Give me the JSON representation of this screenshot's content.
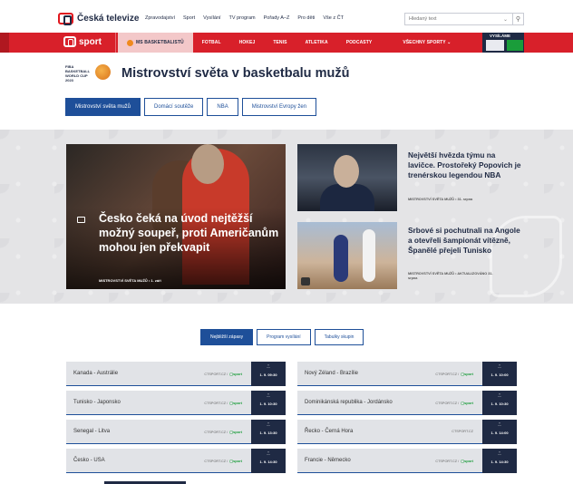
{
  "header": {
    "brand": "Česká televize",
    "nav": [
      "Zpravodajství",
      "Sport",
      "Vysílání",
      "TV program",
      "Pořady A–Z",
      "Pro děti",
      "Vše z ČT"
    ],
    "search_placeholder": "Hledaný text"
  },
  "sportbar": {
    "brand": "sport",
    "items": [
      {
        "label": "MS BASKETBALISTŮ",
        "active": true
      },
      {
        "label": "FOTBAL",
        "active": false
      },
      {
        "label": "HOKEJ",
        "active": false
      },
      {
        "label": "TENIS",
        "active": false
      },
      {
        "label": "ATLETIKA",
        "active": false
      },
      {
        "label": "PODCASTY",
        "active": false
      },
      {
        "label": "VŠECHNY SPORTY ⌄",
        "active": false
      }
    ],
    "live_label": "VYSÍLÁME"
  },
  "page": {
    "logo_text": "FIBA BASKETBALL WORLD CUP 2023",
    "title": "Mistrovství světa v basketbalu mužů",
    "tabs": [
      {
        "label": "Mistrovství světa mužů",
        "active": true
      },
      {
        "label": "Domácí soutěže",
        "active": false
      },
      {
        "label": "NBA",
        "active": false
      },
      {
        "label": "Mistrovství Evropy žen",
        "active": false
      }
    ]
  },
  "hero": {
    "main": {
      "headline": "Česko čeká na úvod nejtěžší možný soupeř, proti Američanům mohou jen překvapit",
      "meta": "MISTROVSTVÍ SVĚTA MUŽŮ • 1. září"
    },
    "side": [
      {
        "title": "Největší hvězda týmu na lavičce. Prostořeký Popovich je trenérskou legendou NBA",
        "meta": "MISTROVSTVÍ SVĚTA MUŽŮ • 31. srpna"
      },
      {
        "title": "Srbové si pochutnali na Angole a otevřeli šampionát vítězně, Španělé přejeli Tunisko",
        "meta": "MISTROVSTVÍ SVĚTA MUŽŮ • AKTUALIZOVÁNO 31. srpna"
      }
    ]
  },
  "schedule": {
    "tabs": [
      {
        "label": "Nejbližší zápasy",
        "active": true
      },
      {
        "label": "Program vysílání",
        "active": false
      },
      {
        "label": "Tabulky skupin",
        "active": false
      }
    ],
    "games": [
      {
        "teams": "Kanada - Austrálie",
        "channel": "CTSPORT.CZ /",
        "has_sport": true,
        "time": "1. 9. 09:30"
      },
      {
        "teams": "Nový Zéland - Brazílie",
        "channel": "CTSPORT.CZ /",
        "has_sport": true,
        "time": "1. 9. 10:00"
      },
      {
        "teams": "Tunisko - Japonsko",
        "channel": "CTSPORT.CZ /",
        "has_sport": true,
        "time": "1. 9. 10:30"
      },
      {
        "teams": "Dominikánská republika - Jordánsko",
        "channel": "CTSPORT.CZ /",
        "has_sport": true,
        "time": "1. 9. 10:30"
      },
      {
        "teams": "Senegal - Litva",
        "channel": "CTSPORT.CZ /",
        "has_sport": true,
        "time": "1. 9. 13:30"
      },
      {
        "teams": "Řecko - Černá Hora",
        "channel": "CTSPORT.CZ",
        "has_sport": false,
        "time": "1. 9. 14:00"
      },
      {
        "teams": "Česko - USA",
        "channel": "CTSPORT.CZ /",
        "has_sport": true,
        "time": "1. 9. 14:30"
      },
      {
        "teams": "Francie - Německo",
        "channel": "CTSPORT.CZ /",
        "has_sport": true,
        "time": "1. 9. 14:30"
      }
    ]
  }
}
